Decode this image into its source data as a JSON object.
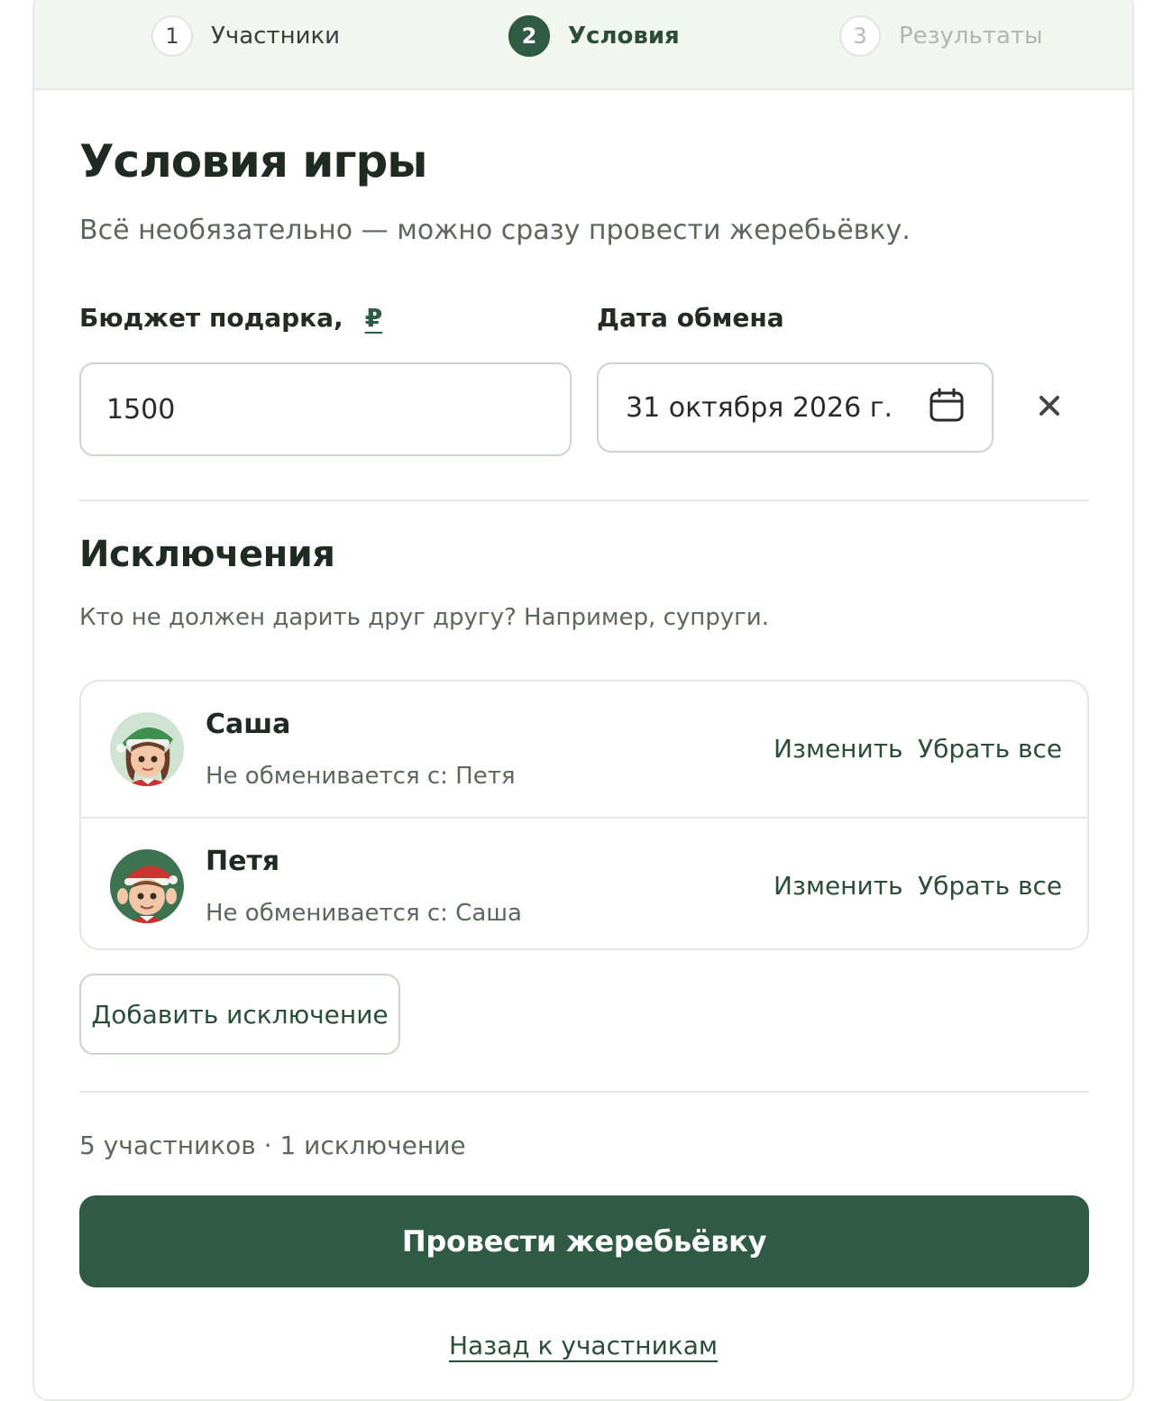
{
  "stepper": {
    "steps": [
      {
        "num": "1",
        "label": "Участники",
        "state": "done"
      },
      {
        "num": "2",
        "label": "Условия",
        "state": "active"
      },
      {
        "num": "3",
        "label": "Результаты",
        "state": "upcoming"
      }
    ]
  },
  "page": {
    "title": "Условия игры",
    "subtitle": "Всё необязательно — можно сразу провести жеребьёвку."
  },
  "budget": {
    "label": "Бюджет подарка,",
    "currency": "₽",
    "value": "1500"
  },
  "date": {
    "label": "Дата обмена",
    "value": "31 октября 2026 г.",
    "calendar_icon": "calendar-icon",
    "clear_icon": "close-icon"
  },
  "exclusions": {
    "title": "Исключения",
    "description": "Кто не должен дарить друг другу? Например, супруги.",
    "items": [
      {
        "name": "Саша",
        "detail": "Не обменивается с: Петя",
        "edit_label": "Изменить",
        "remove_label": "Убрать все",
        "avatar_icon": "elf-girl-avatar"
      },
      {
        "name": "Петя",
        "detail": "Не обменивается с: Саша",
        "edit_label": "Изменить",
        "remove_label": "Убрать все",
        "avatar_icon": "elf-boy-avatar"
      }
    ],
    "add_label": "Добавить исключение"
  },
  "summary": "5 участников · 1 исключение",
  "actions": {
    "primary_label": "Провести жеребьёвку",
    "back_label": "Назад к участникам"
  },
  "colors": {
    "brand": "#2f5a43",
    "header_bg": "#f3f5f1",
    "muted_text": "#5e6660"
  }
}
